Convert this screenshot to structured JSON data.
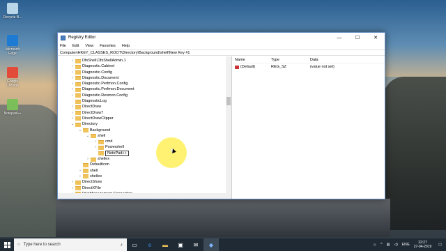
{
  "desktop": {
    "icons": [
      {
        "label": "Recycle B...",
        "icon": "recycle-bin-icon",
        "color": "#b9d6e8"
      },
      {
        "label": "Microsoft Edge",
        "icon": "edge-icon",
        "color": "#1e7bd4"
      },
      {
        "label": "Google Chrome",
        "icon": "chrome-icon",
        "color": "#e24a3a"
      },
      {
        "label": "Notepad++",
        "icon": "notepadpp-icon",
        "color": "#7bbf5a"
      }
    ]
  },
  "window": {
    "title": "Registry Editor",
    "menu": [
      "File",
      "Edit",
      "View",
      "Favorites",
      "Help"
    ],
    "address": "Computer\\HKEY_CLASSES_ROOT\\Directory\\Background\\shell\\New Key #1",
    "tree": [
      {
        "label": "DfsShell.DfsShellAdmin.1",
        "arrow": "›",
        "indent": 0
      },
      {
        "label": "Diagnostic.Cabinet",
        "arrow": "›",
        "indent": 0
      },
      {
        "label": "Diagnostic.Config",
        "arrow": "›",
        "indent": 0
      },
      {
        "label": "Diagnostic.Document",
        "arrow": "›",
        "indent": 0
      },
      {
        "label": "Diagnostic.Perfmon.Config",
        "arrow": "›",
        "indent": 0
      },
      {
        "label": "Diagnostic.Perfmon.Document",
        "arrow": "›",
        "indent": 0
      },
      {
        "label": "Diagnostic.Resmon.Config",
        "arrow": "›",
        "indent": 0
      },
      {
        "label": "DiagnosticLog",
        "arrow": "",
        "indent": 0
      },
      {
        "label": "DirectDraw",
        "arrow": "›",
        "indent": 0
      },
      {
        "label": "DirectDraw7",
        "arrow": "›",
        "indent": 0
      },
      {
        "label": "DirectDrawClipper",
        "arrow": "›",
        "indent": 0
      },
      {
        "label": "Directory",
        "arrow": "⌄",
        "indent": 0
      },
      {
        "label": "Background",
        "arrow": "⌄",
        "indent": 1
      },
      {
        "label": "shell",
        "arrow": "⌄",
        "indent": 2
      },
      {
        "label": "cmd",
        "arrow": "›",
        "indent": 3
      },
      {
        "label": "Powershell",
        "arrow": "›",
        "indent": 3
      },
      {
        "label": "NotePad++",
        "arrow": "",
        "indent": 3,
        "editing": true
      },
      {
        "label": "shellex",
        "arrow": "›",
        "indent": 2
      },
      {
        "label": "DefaultIcon",
        "arrow": "",
        "indent": 1
      },
      {
        "label": "shell",
        "arrow": "›",
        "indent": 1
      },
      {
        "label": "shellex",
        "arrow": "›",
        "indent": 1
      },
      {
        "label": "DirectShow",
        "arrow": "›",
        "indent": 0
      },
      {
        "label": "DirectXFile",
        "arrow": "›",
        "indent": 0
      },
      {
        "label": "DiskManagement.Connection",
        "arrow": "›",
        "indent": 0
      }
    ],
    "values": {
      "headers": [
        "Name",
        "Type",
        "Data"
      ],
      "rows": [
        {
          "name": "(Default)",
          "type": "REG_SZ",
          "data": "(value not set)"
        }
      ]
    }
  },
  "taskbar": {
    "search_placeholder": "Type here to search",
    "time": "22:27",
    "date": "27-04-2019",
    "lang": "ENG"
  }
}
